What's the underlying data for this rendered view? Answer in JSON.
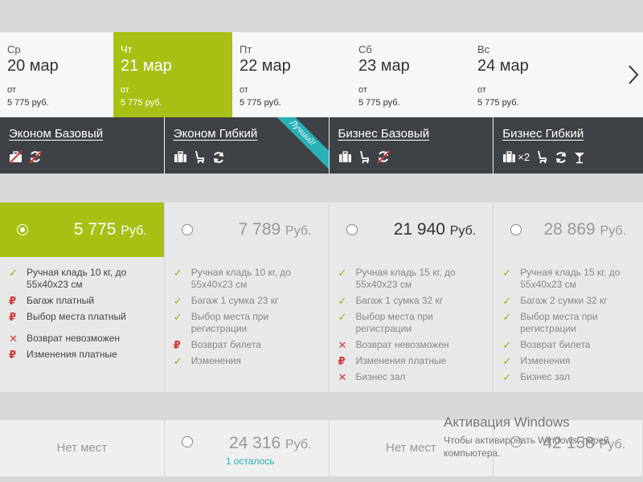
{
  "dates": [
    {
      "dow": "Ср",
      "day": "20 мар",
      "from": "от",
      "price": "5 775 руб.",
      "active": false
    },
    {
      "dow": "Чт",
      "day": "21 мар",
      "from": "от",
      "price": "5 775 руб.",
      "active": true
    },
    {
      "dow": "Пт",
      "day": "22 мар",
      "from": "от",
      "price": "5 775 руб.",
      "active": false
    },
    {
      "dow": "Сб",
      "day": "23 мар",
      "from": "от",
      "price": "5 775 руб.",
      "active": false
    },
    {
      "dow": "Вс",
      "day": "24 мар",
      "from": "от",
      "price": "5 775 руб.",
      "active": false
    }
  ],
  "fares": [
    {
      "name": "Эконом Базовый"
    },
    {
      "name": "Эконом Гибкий",
      "ribbon": "Лучший!"
    },
    {
      "name": "Бизнес Базовый"
    },
    {
      "name": "Бизнес Гибкий",
      "bag_count": "×2"
    }
  ],
  "offers": [
    {
      "amount": "5 775",
      "currency": "Руб.",
      "selected": true,
      "features": [
        {
          "mark": "ok",
          "text": "Ручная кладь 10 кг, до 55х40х23 см"
        },
        {
          "mark": "rub",
          "text": "Багаж платный"
        },
        {
          "mark": "rub",
          "text": "Выбор места платный"
        },
        {
          "mark": "no",
          "text": "Возврат невозможен",
          "gap": true
        },
        {
          "mark": "rub",
          "text": "Изменения платные"
        }
      ]
    },
    {
      "amount": "7 789",
      "currency": "Руб.",
      "selected": false,
      "features": [
        {
          "mark": "ok",
          "text": "Ручная кладь 10 кг, до 55х40х23 см"
        },
        {
          "mark": "ok",
          "text": "Багаж 1 сумка 23 кг"
        },
        {
          "mark": "ok",
          "text": "Выбор места при регистрации"
        },
        {
          "mark": "rub",
          "text": "Возврат билета"
        },
        {
          "mark": "ok",
          "text": "Изменения"
        }
      ]
    },
    {
      "amount": "21 940",
      "currency": "Руб.",
      "selected": false,
      "dark": true,
      "features": [
        {
          "mark": "ok",
          "text": "Ручная кладь 15 кг, до 55х40х23 см"
        },
        {
          "mark": "ok",
          "text": "Багаж 1 сумка 32 кг"
        },
        {
          "mark": "ok",
          "text": "Выбор места при регистрации"
        },
        {
          "mark": "no",
          "text": "Возврат невозможен"
        },
        {
          "mark": "rub",
          "text": "Изменения платные"
        },
        {
          "mark": "no",
          "text": "Бизнес зал"
        }
      ]
    },
    {
      "amount": "28 869",
      "currency": "Руб.",
      "selected": false,
      "features": [
        {
          "mark": "ok",
          "text": "Ручная кладь 15 кг, до 55х40х23 см"
        },
        {
          "mark": "ok",
          "text": "Багаж 2 сумки 32 кг"
        },
        {
          "mark": "ok",
          "text": "Выбор места при регистрации"
        },
        {
          "mark": "ok",
          "text": "Возврат билета"
        },
        {
          "mark": "ok",
          "text": "Изменения"
        },
        {
          "mark": "ok",
          "text": "Бизнес зал"
        }
      ]
    }
  ],
  "second_row": [
    {
      "type": "none",
      "label": "Нет мест"
    },
    {
      "type": "price",
      "amount": "24 316",
      "currency": "Руб.",
      "left": "1 осталось"
    },
    {
      "type": "none",
      "label": "Нет мест"
    },
    {
      "type": "price",
      "amount": "42 158",
      "currency": "Руб."
    }
  ],
  "activation": {
    "title": "Активация Windows",
    "text": "Чтобы активировать Windows, перей компьютера."
  }
}
